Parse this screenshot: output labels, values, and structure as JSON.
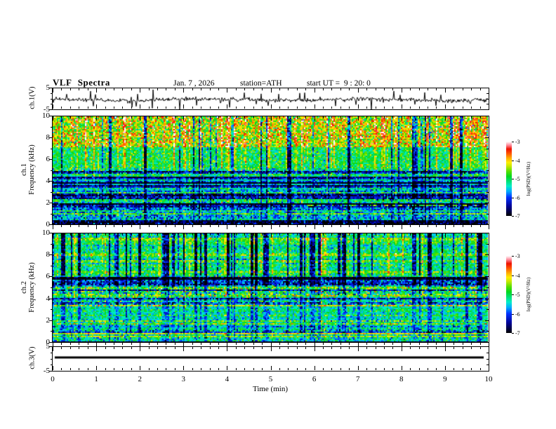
{
  "header": {
    "title": "VLF Spectra",
    "date": "Jan. 7 , 2026",
    "station": "station=ATH",
    "start_ut": "start UT =  9 : 20: 0"
  },
  "x_axis": {
    "label": "Time (min)",
    "tick_labels": [
      "0",
      "1",
      "2",
      "3",
      "4",
      "5",
      "6",
      "7",
      "8",
      "9",
      "10"
    ],
    "range": [
      0,
      10
    ],
    "minor_per_major": 5
  },
  "panels": {
    "ch1_wave": {
      "ylabel": "ch.1(V)",
      "tick_labels": [
        "5",
        "-5"
      ],
      "ylim": [
        -5,
        5
      ]
    },
    "ch1_spec": {
      "ylabel_line1": "ch.1",
      "ylabel_line2": "Frequency (kHz)",
      "tick_labels": [
        "10",
        "8",
        "6",
        "4",
        "2",
        "0"
      ],
      "ylim": [
        0,
        10
      ]
    },
    "ch2_spec": {
      "ylabel_line1": "ch.2",
      "ylabel_line2": "Frequency (kHz)",
      "tick_labels": [
        "10",
        "8",
        "6",
        "4",
        "2",
        "0"
      ],
      "ylim": [
        0,
        10
      ]
    },
    "ch3_wave": {
      "ylabel": "ch.3(V)",
      "tick_labels": [
        "5",
        "-5"
      ],
      "ylim": [
        -5,
        5
      ]
    }
  },
  "colorbar": {
    "tick_labels": [
      "-3",
      "-4",
      "-5",
      "-6",
      "-7"
    ],
    "label": "log(PSD)(V²/Hz)",
    "range": [
      -7,
      -3
    ]
  },
  "palette": {
    "stops": [
      [
        0.0,
        "#000000"
      ],
      [
        0.125,
        "#000090"
      ],
      [
        0.25,
        "#0030ff"
      ],
      [
        0.33,
        "#00aaff"
      ],
      [
        0.4,
        "#00eec8"
      ],
      [
        0.47,
        "#00e070"
      ],
      [
        0.53,
        "#00d820"
      ],
      [
        0.6,
        "#55e000"
      ],
      [
        0.67,
        "#c8e800"
      ],
      [
        0.72,
        "#ffee00"
      ],
      [
        0.78,
        "#ffaa00"
      ],
      [
        0.84,
        "#ff5500"
      ],
      [
        0.9,
        "#ee1100"
      ],
      [
        0.95,
        "#ff8899"
      ],
      [
        1.0,
        "#ffffff"
      ]
    ]
  },
  "chart_data": [
    {
      "type": "line",
      "name": "ch1_waveform",
      "ylabel": "ch.1(V)",
      "xlabel": "Time (min)",
      "ylim": [
        -5,
        5
      ],
      "xlim": [
        0,
        10
      ],
      "baseline": -0.4,
      "noise_sd": 0.5,
      "spike_prob": 0.05,
      "spike_max": 3.5,
      "color": "#000000",
      "seed": 5
    },
    {
      "type": "heatmap",
      "name": "ch1_spectrogram",
      "ylabel": "ch.1 Frequency (kHz)",
      "xlabel": "Time (min)",
      "ylim": [
        0,
        10
      ],
      "xlim": [
        0,
        10
      ],
      "value_range": [
        -7,
        -3
      ],
      "bands": [
        {
          "f": [
            7.2,
            10.0
          ],
          "mean": -4.35,
          "sd": 0.55,
          "streak": 1.0
        },
        {
          "f": [
            5.2,
            7.2
          ],
          "mean": -5.05,
          "sd": 0.35,
          "streak": 1.0
        },
        {
          "f": [
            4.7,
            5.2
          ],
          "mean": -5.9,
          "sd": 0.45,
          "streak": 0.6,
          "rowvar": 0.25
        },
        {
          "f": [
            3.2,
            4.7
          ],
          "mean": -6.25,
          "sd": 0.35,
          "streak": 0.5,
          "rowvar": 0.3
        },
        {
          "f": [
            2.35,
            3.2
          ],
          "mean": -5.8,
          "sd": 0.4,
          "streak": 0.5,
          "rowvar": 0.25
        },
        {
          "f": [
            1.0,
            2.35
          ],
          "mean": -6.05,
          "sd": 0.4,
          "streak": 0.5,
          "rowvar": 0.3
        },
        {
          "f": [
            0.45,
            1.0
          ],
          "mean": -5.7,
          "sd": 0.45,
          "streak": 0.5
        },
        {
          "f": [
            0.0,
            0.45
          ],
          "mean": -6.85,
          "sd": 0.45,
          "streak": 0.2
        }
      ],
      "lines": [
        {
          "f": 5.6,
          "mean": -5.2,
          "coverage": 0.5
        },
        {
          "f": 5.05,
          "mean": -4.6,
          "coverage": 0.18
        },
        {
          "f": 4.05,
          "mean": -5.35,
          "coverage": 0.85
        },
        {
          "f": 3.15,
          "mean": -5.45,
          "coverage": 0.7
        },
        {
          "f": 2.25,
          "mean": -5.05,
          "coverage": 0.9
        },
        {
          "f": 1.8,
          "mean": -4.55,
          "coverage": 0.3,
          "x_from": 0.55
        },
        {
          "f": 0.95,
          "mean": -4.7,
          "coverage": 0.9
        },
        {
          "f": 0.5,
          "mean": -5.4,
          "coverage": 0.6
        }
      ],
      "streaks": {
        "bright_prob": 0.22,
        "bright_delta": 0.55,
        "dark_prob": 0.09,
        "dark_delta": -1.5,
        "hot_prob": 0.05,
        "hot_delta": 1.0
      },
      "seed": 11
    },
    {
      "type": "heatmap",
      "name": "ch2_spectrogram",
      "ylabel": "ch.2 Frequency (kHz)",
      "xlabel": "Time (min)",
      "ylim": [
        0,
        10
      ],
      "xlim": [
        0,
        10
      ],
      "value_range": [
        -7,
        -3
      ],
      "bands": [
        {
          "f": [
            6.1,
            10.0
          ],
          "mean": -5.0,
          "sd": 0.35,
          "streak": 1.0,
          "rowvar": 0.15
        },
        {
          "f": [
            5.3,
            6.1
          ],
          "mean": -6.3,
          "sd": 0.45,
          "streak": 0.5,
          "rowvar": 0.25
        },
        {
          "f": [
            4.4,
            5.3
          ],
          "mean": -5.5,
          "sd": 0.5,
          "streak": 0.5,
          "rowvar": 0.2
        },
        {
          "f": [
            3.5,
            4.4
          ],
          "mean": -5.6,
          "sd": 0.45,
          "streak": 0.4,
          "rowvar": 0.2
        },
        {
          "f": [
            2.1,
            3.5
          ],
          "mean": -5.35,
          "sd": 0.3,
          "streak": 0.4
        },
        {
          "f": [
            0.9,
            2.1
          ],
          "mean": -5.5,
          "sd": 0.35,
          "streak": 0.4,
          "rowvar": 0.25
        },
        {
          "f": [
            0.15,
            0.9
          ],
          "mean": -5.3,
          "sd": 0.4,
          "streak": 0.3
        },
        {
          "f": [
            0.0,
            0.15
          ],
          "mean": -6.9,
          "sd": 0.25,
          "streak": 0.1
        }
      ],
      "lines": [
        {
          "f": 4.45,
          "mean": -4.35,
          "coverage": 0.5
        },
        {
          "f": 3.4,
          "mean": -4.05,
          "coverage": 0.8
        },
        {
          "f": 2.95,
          "mean": -4.85,
          "coverage": 0.45
        },
        {
          "f": 2.5,
          "mean": -4.6,
          "coverage": 0.5
        },
        {
          "f": 2.0,
          "mean": -4.45,
          "coverage": 0.8
        },
        {
          "f": 1.7,
          "mean": -4.7,
          "coverage": 0.6
        },
        {
          "f": 1.15,
          "mean": -5.0,
          "coverage": 0.5
        },
        {
          "f": 0.8,
          "mean": -4.15,
          "coverage": 0.95
        },
        {
          "f": 0.55,
          "mean": -4.35,
          "coverage": 0.9
        }
      ],
      "streaks": {
        "bright_prob": 0.1,
        "bright_delta": 0.5,
        "dark_prob": 0.16,
        "dark_delta": -1.6,
        "hot_prob": 0.02,
        "hot_delta": 0.9
      },
      "seed": 23
    },
    {
      "type": "line",
      "name": "ch3_waveform",
      "ylabel": "ch.3(V)",
      "xlabel": "Time (min)",
      "ylim": [
        -5,
        5
      ],
      "xlim": [
        0,
        10
      ],
      "value": 0.6,
      "thickness": 3,
      "color": "#000000"
    }
  ]
}
